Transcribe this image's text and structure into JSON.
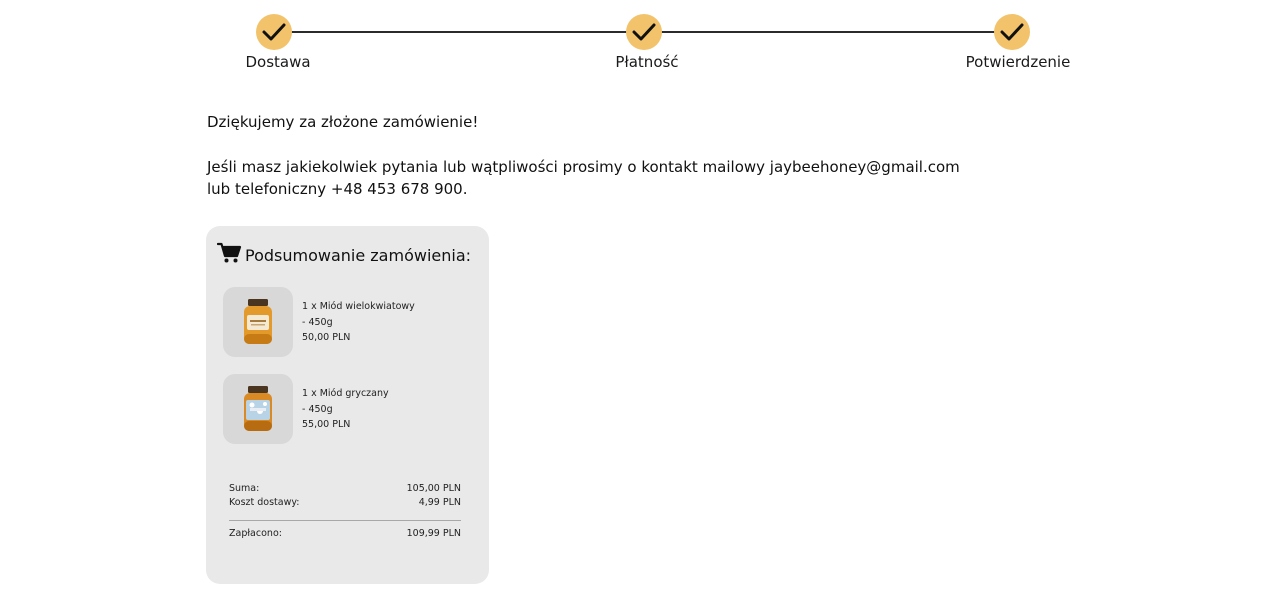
{
  "stepper": {
    "steps": [
      {
        "label": "Dostawa",
        "state": "done"
      },
      {
        "label": "Płatność",
        "state": "done"
      },
      {
        "label": "Potwierdzenie",
        "state": "done"
      }
    ],
    "accent_color": "#f2c36b"
  },
  "message": {
    "thanks": "Dziękujemy za złożone zamówienie!",
    "contact_line1": "Jeśli masz jakiekolwiek pytania lub wątpliwości prosimy o kontakt mailowy jaybeehoney@gmail.com",
    "contact_line2": "lub telefoniczny +48 453 678 900."
  },
  "summary": {
    "icon": "cart-icon",
    "title": "Podsumowanie zamówienia:",
    "items": [
      {
        "line1": "1 x Miód wielokwiatowy",
        "line2": "- 450g",
        "price": "50,00 PLN",
        "image": "honey-jar-orange"
      },
      {
        "line1": "1 x Miód gryczany",
        "line2": "- 450g",
        "price": "55,00 PLN",
        "image": "honey-jar-blue"
      }
    ],
    "totals": {
      "sum_label": "Suma:",
      "sum_value": "105,00 PLN",
      "shipping_label": "Koszt dostawy:",
      "shipping_value": "4,99 PLN",
      "paid_label": "Zapłacono:",
      "paid_value": "109,99 PLN"
    }
  }
}
